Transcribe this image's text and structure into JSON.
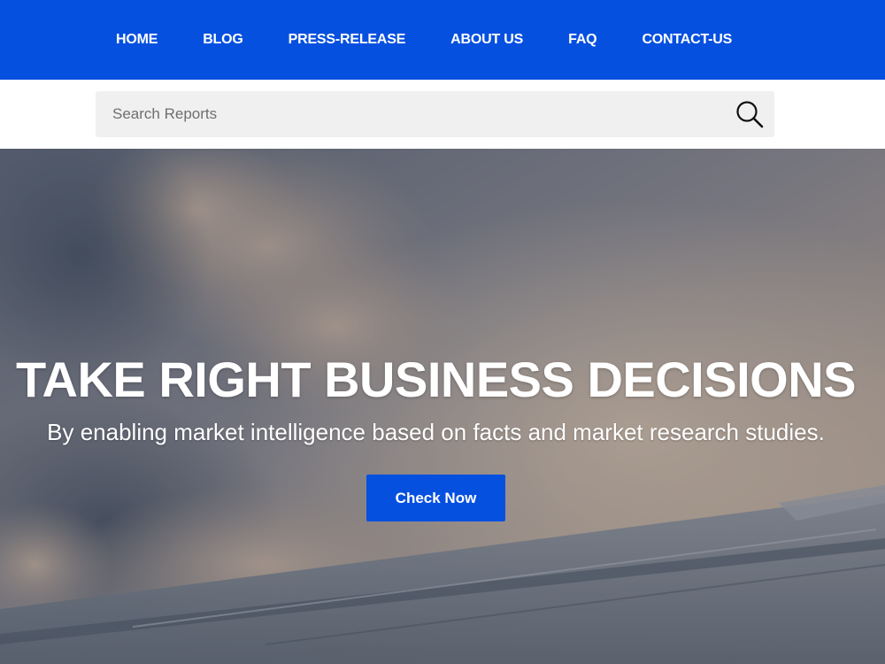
{
  "nav": {
    "items": [
      {
        "label": "HOME"
      },
      {
        "label": "BLOG"
      },
      {
        "label": "PRESS-RELEASE"
      },
      {
        "label": "ABOUT US"
      },
      {
        "label": "FAQ"
      },
      {
        "label": "CONTACT-US"
      }
    ]
  },
  "search": {
    "placeholder": "Search Reports",
    "icon": "search-icon"
  },
  "hero": {
    "title": "TAKE RIGHT BUSINESS DECISIONS",
    "subtitle": "By enabling market intelligence based on facts and market research studies.",
    "cta_label": "Check Now"
  },
  "colors": {
    "brand_blue": "#0650e0",
    "search_bg": "#f0f0f0"
  }
}
